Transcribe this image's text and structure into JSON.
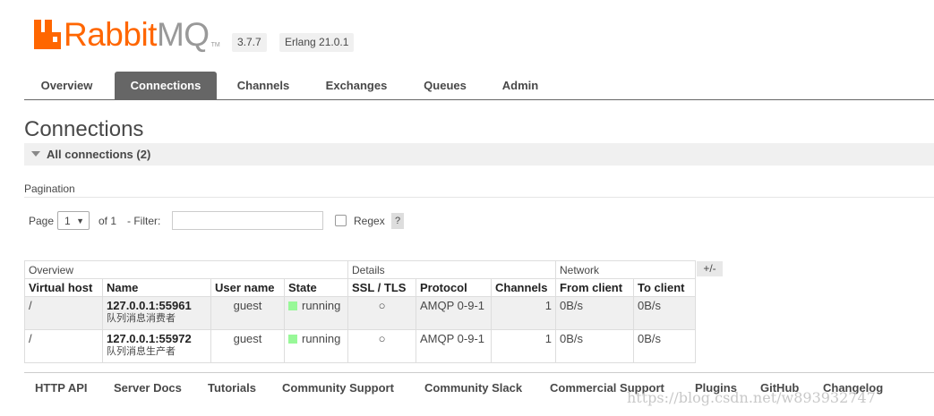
{
  "header": {
    "logo_rabbit": "Rabbit",
    "logo_mq": "MQ",
    "logo_tm": "TM",
    "version": "3.7.7",
    "erlang": "Erlang 21.0.1"
  },
  "tabs": [
    {
      "label": "Overview"
    },
    {
      "label": "Connections",
      "active": true
    },
    {
      "label": "Channels"
    },
    {
      "label": "Exchanges"
    },
    {
      "label": "Queues"
    },
    {
      "label": "Admin"
    }
  ],
  "page_title": "Connections",
  "section": {
    "label": "All connections (2)"
  },
  "pagination": {
    "title": "Pagination",
    "page_label": "Page",
    "page_value": "1",
    "of_label": "of 1",
    "filter_label": "- Filter:",
    "filter_value": "",
    "regex_label": "Regex",
    "help": "?"
  },
  "table": {
    "groups": [
      "Overview",
      "Details",
      "Network"
    ],
    "columns": [
      "Virtual host",
      "Name",
      "User name",
      "State",
      "SSL / TLS",
      "Protocol",
      "Channels",
      "From client",
      "To client"
    ],
    "plus_minus": "+/-",
    "rows": [
      {
        "vhost": "/",
        "name": "127.0.0.1:55961",
        "subname": "队列消息消费者",
        "user": "guest",
        "state": "running",
        "ssl": "○",
        "protocol": "AMQP 0-9-1",
        "channels": "1",
        "from": "0B/s",
        "to": "0B/s"
      },
      {
        "vhost": "/",
        "name": "127.0.0.1:55972",
        "subname": "队列消息生产者",
        "user": "guest",
        "state": "running",
        "ssl": "○",
        "protocol": "AMQP 0-9-1",
        "channels": "1",
        "from": "0B/s",
        "to": "0B/s"
      }
    ]
  },
  "footer": [
    "HTTP API",
    "Server Docs",
    "Tutorials",
    "Community Support",
    "Community Slack",
    "Commercial Support",
    "Plugins",
    "GitHub",
    "Changelog"
  ],
  "watermark": "https://blog.csdn.net/w893932747",
  "colors": {
    "brand": "#ff6600",
    "tab_active": "#666666",
    "running": "#98f898"
  }
}
